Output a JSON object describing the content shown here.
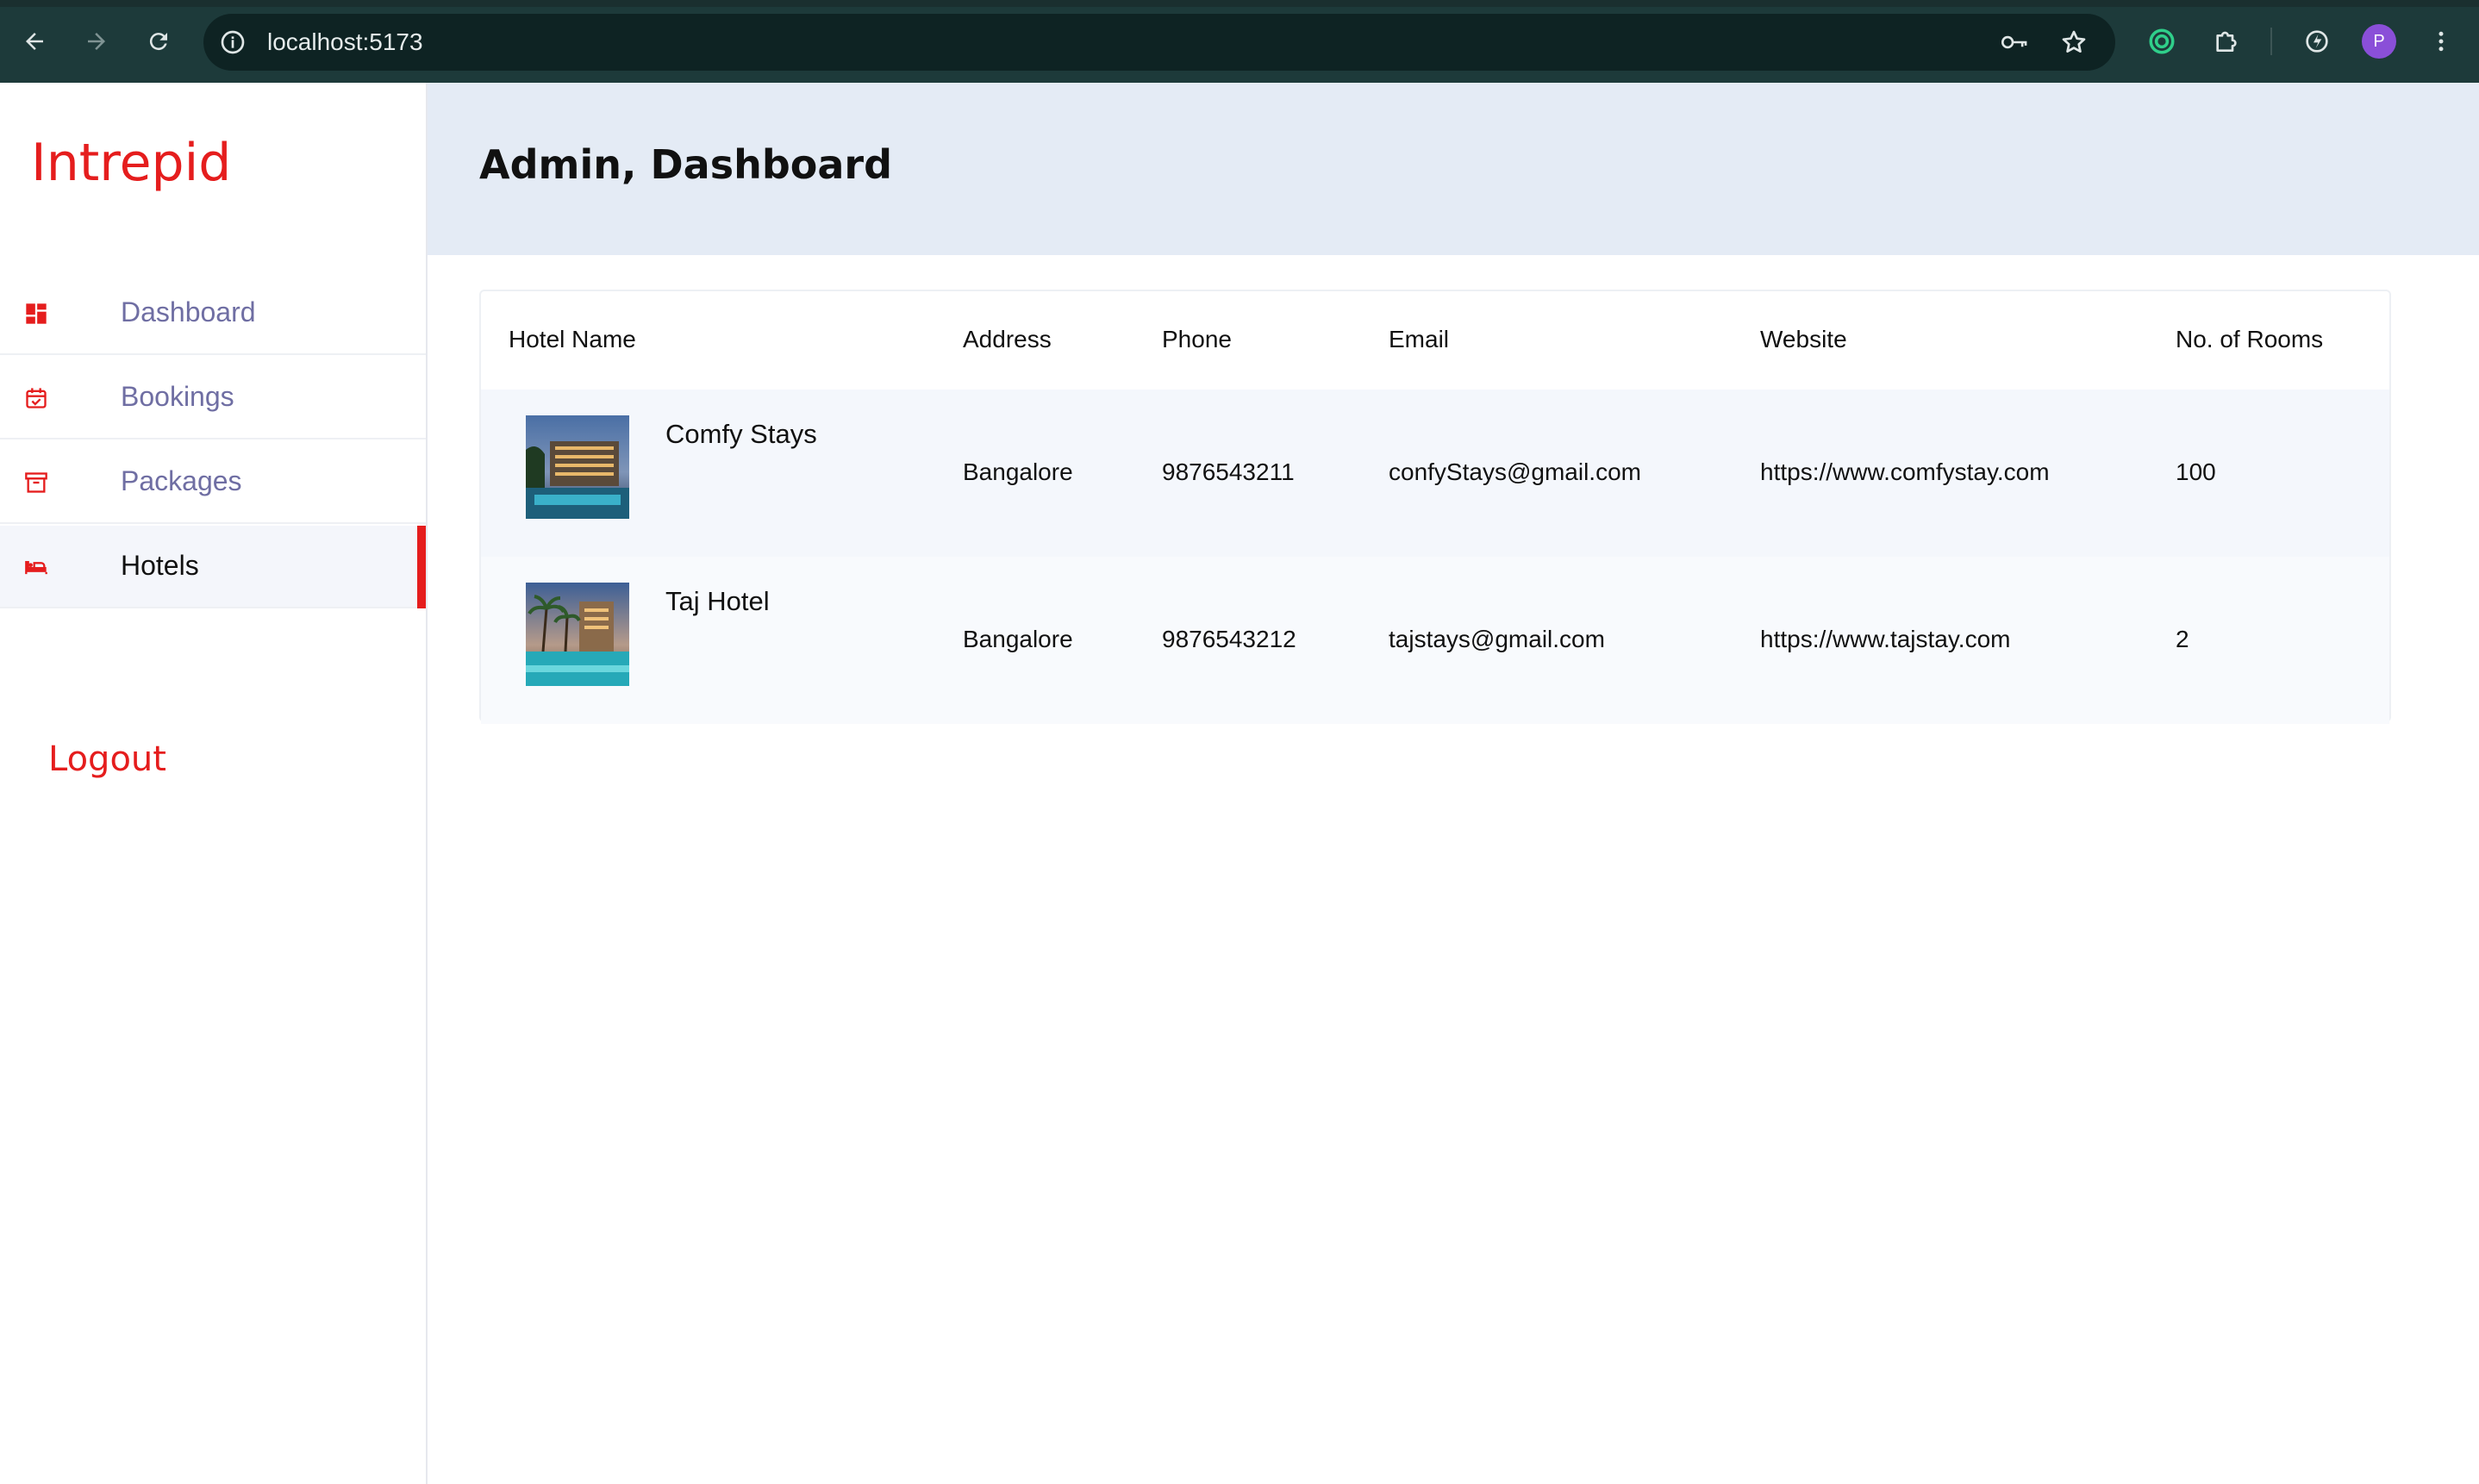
{
  "browser": {
    "url": "localhost:5173",
    "profile_initial": "P",
    "icons": [
      "back-icon",
      "forward-icon",
      "reload-icon",
      "info-icon",
      "key-icon",
      "star-icon",
      "extension-ring-icon",
      "puzzle-icon",
      "sync-icon",
      "menu-dots-icon"
    ]
  },
  "sidebar": {
    "brand": "Intrepid",
    "items": [
      {
        "label": "Dashboard",
        "icon": "dashboard-icon"
      },
      {
        "label": "Bookings",
        "icon": "calendar-icon"
      },
      {
        "label": "Packages",
        "icon": "archive-icon"
      },
      {
        "label": "Hotels",
        "icon": "bed-icon",
        "active": true
      }
    ],
    "logout": "Logout"
  },
  "header": {
    "title": "Admin, Dashboard"
  },
  "table": {
    "columns": [
      "Hotel Name",
      "Address",
      "Phone",
      "Email",
      "Website",
      "No. of Rooms"
    ],
    "rows": [
      {
        "name": "Comfy Stays",
        "address": "Bangalore",
        "phone": "9876543211",
        "email": "confyStays@gmail.com",
        "website": "https://www.comfystay.com",
        "rooms": "100"
      },
      {
        "name": "Taj Hotel",
        "address": "Bangalore",
        "phone": "9876543212",
        "email": "tajstays@gmail.com",
        "website": "https://www.tajstay.com",
        "rooms": "2"
      }
    ]
  },
  "colors": {
    "accent": "#e51d1d",
    "header_bg": "#e4ebf5",
    "nav_text": "#6f6ea3",
    "chrome_bg": "#1d3a3a"
  }
}
